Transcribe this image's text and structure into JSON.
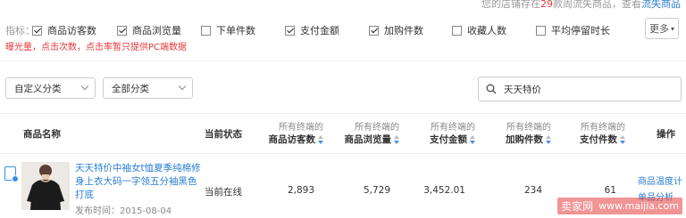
{
  "top_note": {
    "prefix": "您的店铺存在",
    "count": "29",
    "suffix": "款周流失商品，查看",
    "link": "流失商品"
  },
  "metrics": {
    "label": "指标：",
    "items": [
      {
        "label": "商品访客数",
        "checked": true
      },
      {
        "label": "商品浏览量",
        "checked": true
      },
      {
        "label": "下单件数",
        "checked": false
      },
      {
        "label": "支付金额",
        "checked": true
      },
      {
        "label": "加购件数",
        "checked": true
      },
      {
        "label": "收藏人数",
        "checked": false
      },
      {
        "label": "平均停留时长",
        "checked": false
      }
    ],
    "more": "更多"
  },
  "warning": "曝光量，点击次数，点击率暂只提供PC端数据",
  "filters": {
    "category_custom": "自定义分类",
    "category_all": "全部分类",
    "search_value": "天天特价"
  },
  "table": {
    "headers": {
      "name": "商品名称",
      "status": "当前状态",
      "visitors_sub": "所有终端的",
      "visitors": "商品访客数",
      "pageviews_sub": "所有终端的",
      "pageviews": "商品浏览量",
      "payment_sub": "所有终端的",
      "payment": "支付金额",
      "cart_sub": "所有终端的",
      "cart": "加购件数",
      "paid_sub": "所有终端的",
      "paid": "支付件数",
      "ops": "操作"
    },
    "rows": [
      {
        "title": "天天特价中袖女t恤夏季纯棉修身上衣大码一字领五分袖黑色打底",
        "date": "发布时间：2015-08-04",
        "status": "当前在线",
        "visitors": "2,893",
        "pageviews": "5,729",
        "payment": "3,452.01",
        "cart": "234",
        "paid": "61",
        "op1": "商品温度计",
        "op2": "单品分析"
      }
    ]
  },
  "watermark": {
    "brand": "卖家网",
    "url": "www.maijia.com"
  },
  "colors": {
    "accent": "#2a7dd1",
    "warning": "#e4393c"
  }
}
